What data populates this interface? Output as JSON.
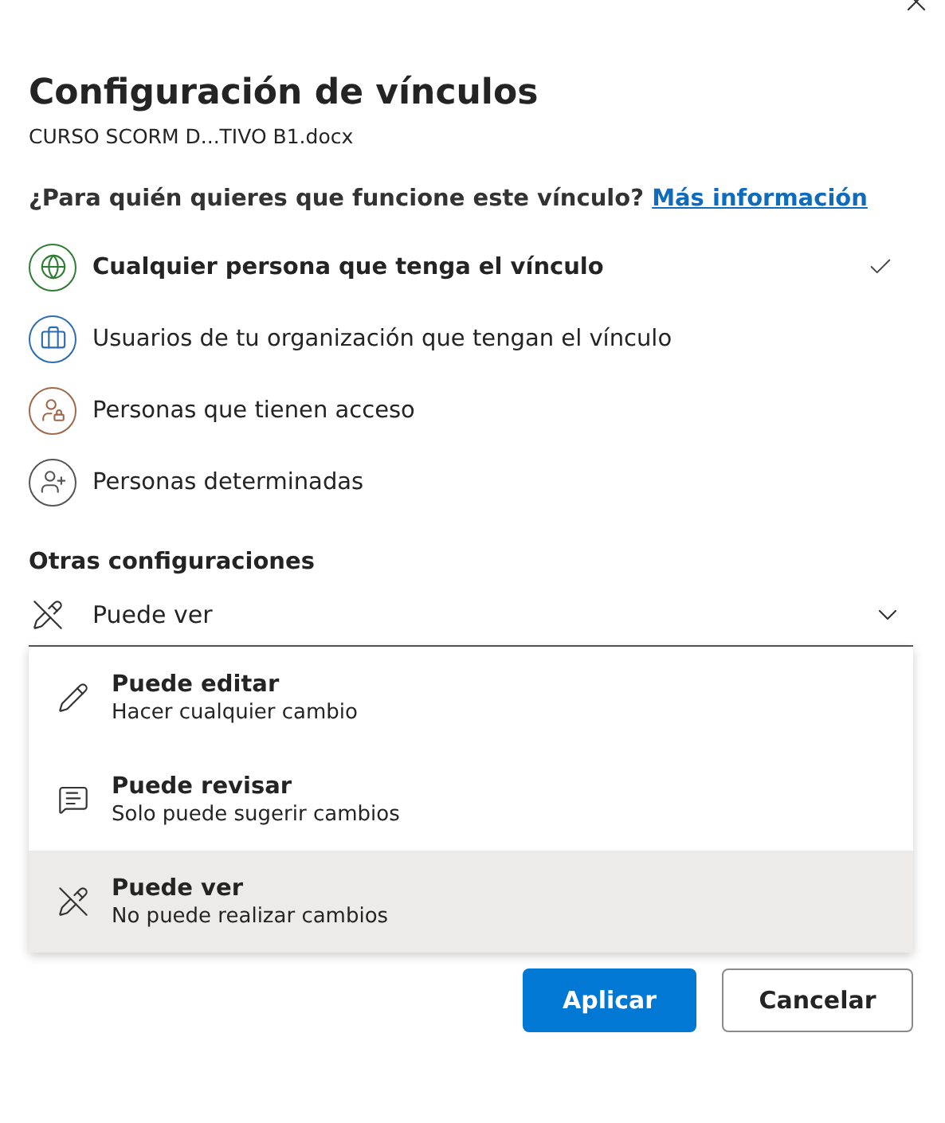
{
  "dialog": {
    "title": "Configuración de vínculos",
    "file_name": "CURSO SCORM D...TIVO B1.docx"
  },
  "audience": {
    "question": "¿Para quién quieres que funcione este vínculo?",
    "link": "Más información",
    "options": [
      {
        "label": "Cualquier persona que tenga el vínculo",
        "kind": "globe",
        "color": "#2e7d32",
        "selected": true
      },
      {
        "label": "Usuarios de tu organización que tengan el vínculo",
        "kind": "briefcase",
        "color": "#2b6cb0",
        "selected": false
      },
      {
        "label": "Personas que tienen acceso",
        "kind": "people-lock",
        "color": "#a0674b",
        "selected": false
      },
      {
        "label": "Personas determinadas",
        "kind": "people-add",
        "color": "#555555",
        "selected": false
      }
    ]
  },
  "other_settings": {
    "heading": "Otras configuraciones",
    "permission": {
      "value": "Puede ver",
      "kind": "no-edit"
    },
    "menu": [
      {
        "title": "Puede editar",
        "description": "Hacer cualquier cambio",
        "kind": "edit",
        "selected": false
      },
      {
        "title": "Puede revisar",
        "description": "Solo puede sugerir cambios",
        "kind": "review",
        "selected": false
      },
      {
        "title": "Puede ver",
        "description": "No puede realizar cambios",
        "kind": "no-edit",
        "selected": true
      }
    ]
  },
  "buttons": [
    {
      "label": "Aplicar",
      "kind": "primary"
    },
    {
      "label": "Cancelar",
      "kind": "secondary"
    }
  ]
}
